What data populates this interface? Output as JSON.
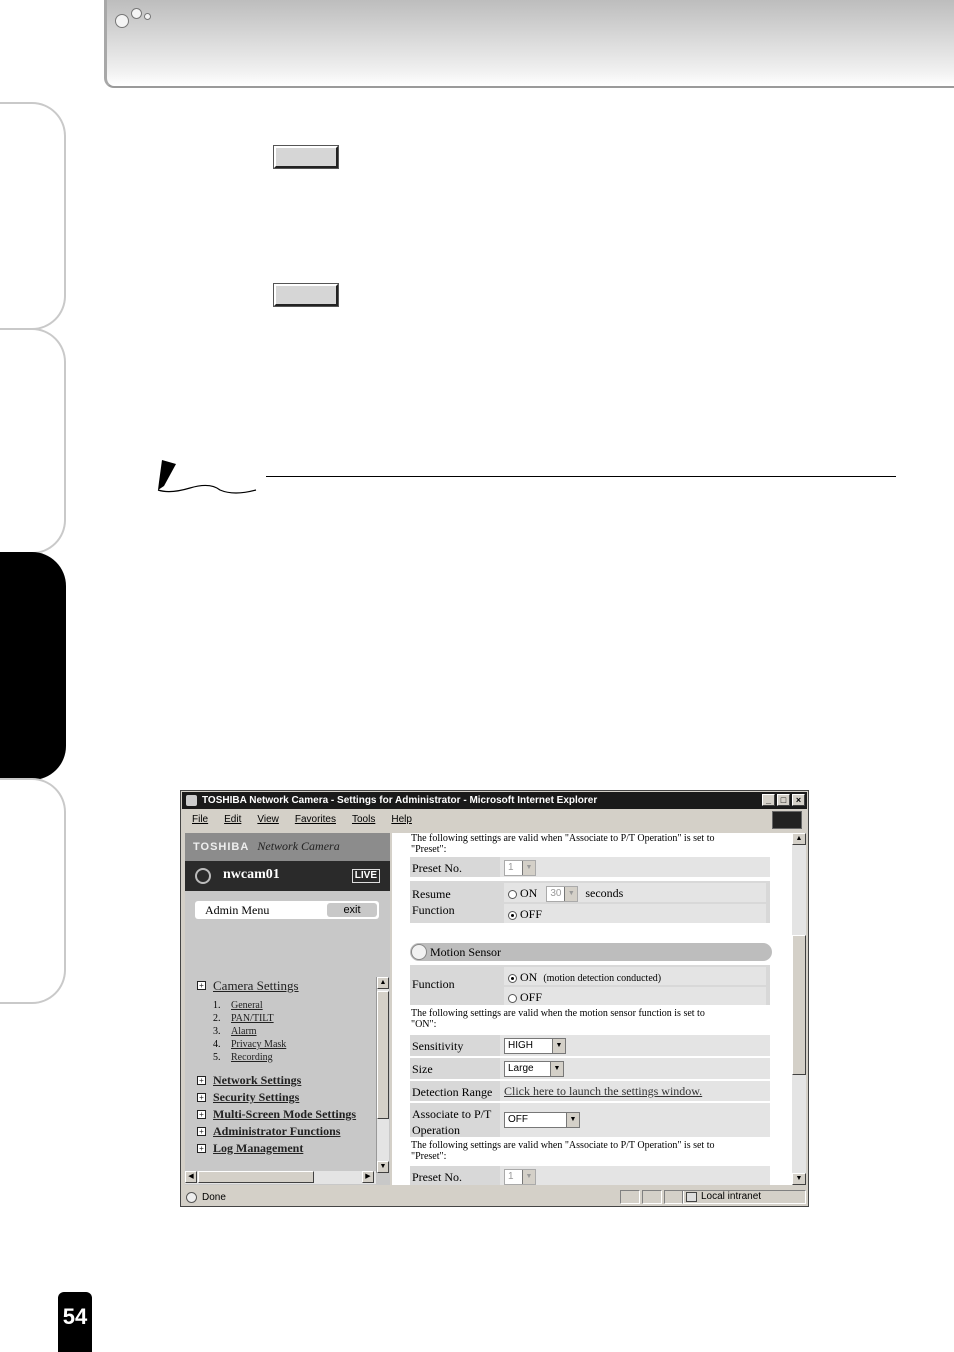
{
  "page": {
    "number": "54"
  },
  "browser": {
    "title": "TOSHIBA Network Camera - Settings for Administrator - Microsoft Internet Explorer",
    "window_buttons": [
      "_",
      "□",
      "×"
    ],
    "menu": [
      "File",
      "Edit",
      "View",
      "Favorites",
      "Tools",
      "Help"
    ],
    "status": {
      "text": "Done",
      "zone": "Local intranet"
    }
  },
  "sidebar": {
    "brand": "TOSHIBA",
    "brand_sub": "Network Camera",
    "camera_name": "nwcam01",
    "live_label": "LIVE",
    "admin_menu": "Admin Menu",
    "exit_label": "exit",
    "sections": [
      {
        "label": "Camera Settings",
        "items": [
          {
            "n": "1.",
            "label": "General"
          },
          {
            "n": "2.",
            "label": "PAN/TILT"
          },
          {
            "n": "3.",
            "label": "Alarm"
          },
          {
            "n": "4.",
            "label": "Privacy Mask"
          },
          {
            "n": "5.",
            "label": "Recording"
          }
        ]
      },
      {
        "label": "Network Settings"
      },
      {
        "label": "Security Settings"
      },
      {
        "label": "Multi-Screen Mode Settings"
      },
      {
        "label": "Administrator Functions"
      },
      {
        "label": "Log Management"
      }
    ]
  },
  "main": {
    "note_preset": "The following settings are valid when \"Associate to P/T Operation\" is set to\n\"Preset\":",
    "preset_no_label": "Preset No.",
    "preset_no_value": "1",
    "resume_label": "Resume\nFunction",
    "resume_on": "ON",
    "resume_seconds_value": "30",
    "resume_seconds_label": "seconds",
    "resume_off": "OFF",
    "motion_header": "Motion Sensor",
    "function_label": "Function",
    "function_on": "ON",
    "function_on_note": "(motion detection conducted)",
    "function_off": "OFF",
    "note_on": "The following settings are valid when the motion sensor function is set to\n\"ON\":",
    "sensitivity_label": "Sensitivity",
    "sensitivity_value": "HIGH",
    "size_label": "Size",
    "size_value": "Large",
    "range_label": "Detection Range",
    "range_link": "Click here to launch the settings window.",
    "assoc_label": "Associate to P/T\nOperation",
    "assoc_value": "OFF",
    "note_preset_2": "The following settings are valid when \"Associate to P/T Operation\" is set to\n\"Preset\":",
    "preset_no_label_2": "Preset No.",
    "preset_no_value_2": "1"
  }
}
